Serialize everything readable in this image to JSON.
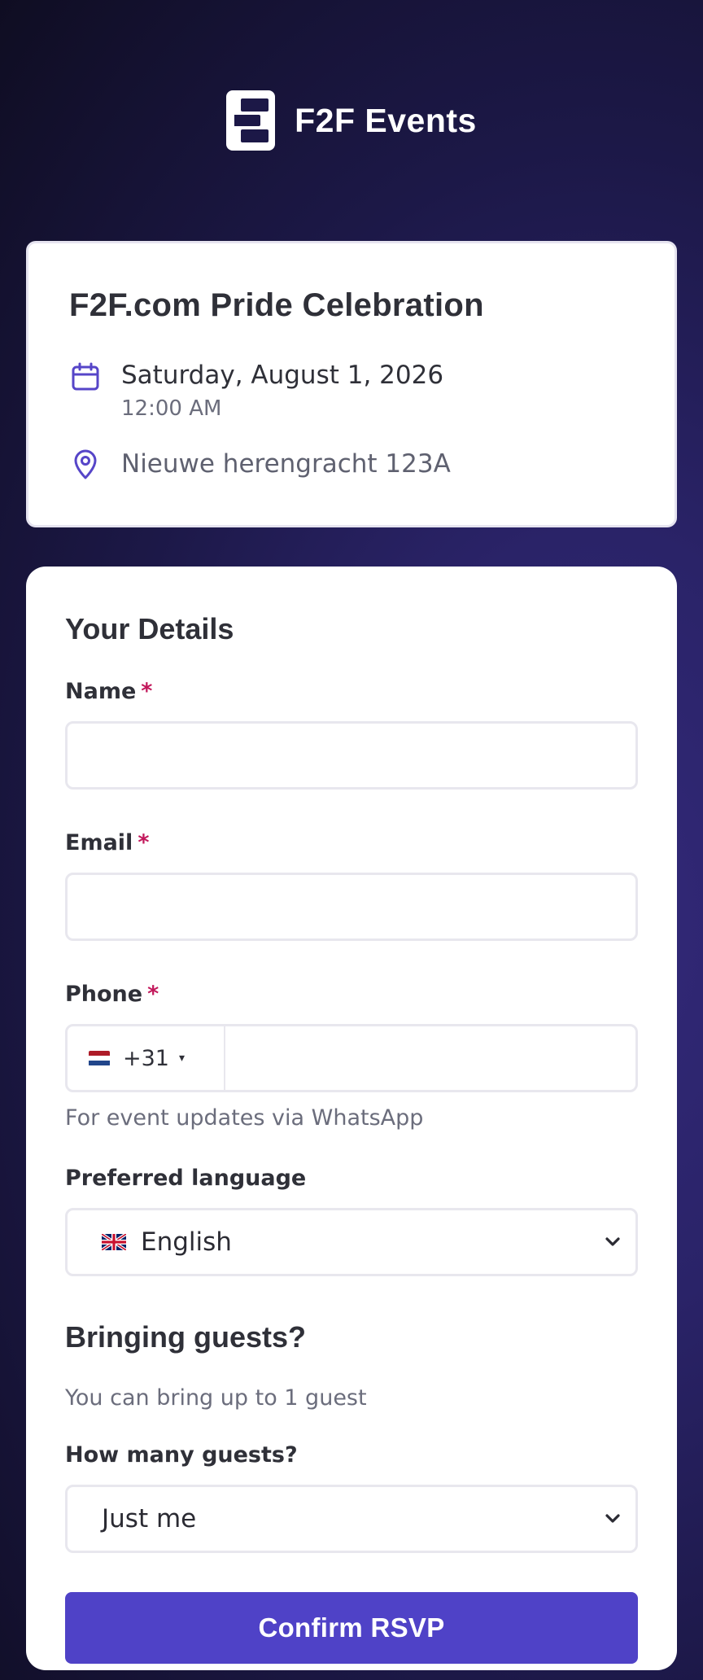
{
  "brand": {
    "name": "F2F Events",
    "logo_icon": "f2f-logo-icon"
  },
  "event": {
    "title": "F2F.com Pride Celebration",
    "date": "Saturday, August 1, 2026",
    "time": "12:00 AM",
    "location": "Nieuwe herengracht 123A",
    "calendar_icon": "calendar-icon",
    "location_icon": "map-pin-icon"
  },
  "form": {
    "section_title": "Your Details",
    "name": {
      "label": "Name",
      "required_mark": "*",
      "value": ""
    },
    "email": {
      "label": "Email",
      "required_mark": "*",
      "value": ""
    },
    "phone": {
      "label": "Phone",
      "required_mark": "*",
      "country_flag": "netherlands-flag-icon",
      "dial_code": "+31",
      "caret": "▾",
      "value": "",
      "hint": "For event updates via WhatsApp"
    },
    "language": {
      "label": "Preferred language",
      "flag": "uk-flag-icon",
      "selected": "English"
    },
    "guests": {
      "section_title": "Bringing guests?",
      "note": "You can bring up to 1 guest",
      "label": "How many guests?",
      "selected": "Just me"
    },
    "submit_label": "Confirm RSVP"
  },
  "colors": {
    "accent": "#4f42c7",
    "icon": "#5645c8",
    "required": "#c2185b",
    "background_dark": "#0f0d22",
    "background_purple": "#33297a"
  }
}
